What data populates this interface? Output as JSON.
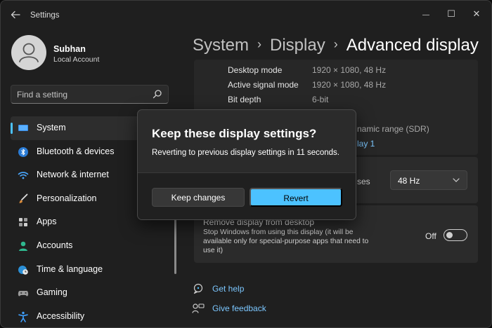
{
  "window": {
    "title": "Settings",
    "minimize_glyph": "—",
    "maximize_glyph": "☐",
    "close_glyph": "✕"
  },
  "user": {
    "name": "Subhan",
    "account_type": "Local Account"
  },
  "search": {
    "placeholder": "Find a setting"
  },
  "sidebar": {
    "items": [
      {
        "label": "System",
        "icon": "monitor-icon",
        "selected": true
      },
      {
        "label": "Bluetooth & devices",
        "icon": "bluetooth-icon"
      },
      {
        "label": "Network & internet",
        "icon": "wifi-icon"
      },
      {
        "label": "Personalization",
        "icon": "brush-icon"
      },
      {
        "label": "Apps",
        "icon": "apps-icon"
      },
      {
        "label": "Accounts",
        "icon": "person-icon"
      },
      {
        "label": "Time & language",
        "icon": "globe-clock-icon"
      },
      {
        "label": "Gaming",
        "icon": "gamepad-icon"
      },
      {
        "label": "Accessibility",
        "icon": "accessibility-icon"
      }
    ]
  },
  "breadcrumb": {
    "first": "System",
    "second": "Display",
    "current": "Advanced display",
    "separator": "›"
  },
  "display_info": {
    "rows": [
      {
        "label": "Desktop mode",
        "value": "1920 × 1080, 48 Hz"
      },
      {
        "label": "Active signal mode",
        "value": "1920 × 1080, 48 Hz"
      },
      {
        "label": "Bit depth",
        "value": "6-bit"
      }
    ],
    "partial_color_text": "namic range (SDR)",
    "partial_link_text": "lay 1"
  },
  "refresh_rate": {
    "partial_label": "ses",
    "selected": "48 Hz"
  },
  "remove_display": {
    "title": "Remove display from desktop",
    "description": "Stop Windows from using this display (it will be available only for special-purpose apps that need to use it)",
    "toggle_state": "Off"
  },
  "help": {
    "get_help": "Get help",
    "give_feedback": "Give feedback"
  },
  "dialog": {
    "title": "Keep these display settings?",
    "message": "Reverting to previous display settings in 11 seconds.",
    "keep_button": "Keep changes",
    "revert_button": "Revert"
  },
  "colors": {
    "accent": "#4cc2ff",
    "link": "#7cc7ff",
    "background": "#1f1f1f",
    "card": "#2b2b2b"
  }
}
